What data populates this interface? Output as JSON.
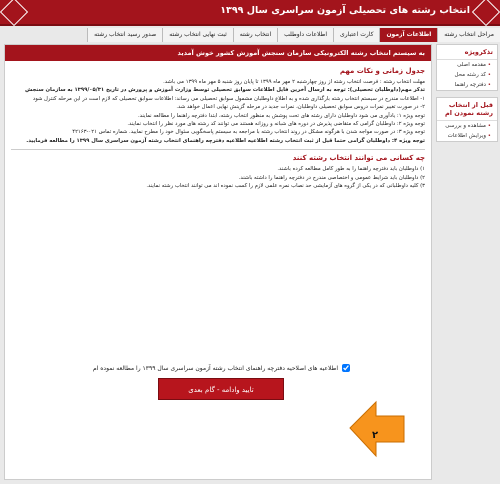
{
  "header": {
    "title": "انتخاب رشته های تحصیلی آزمون سراسری سال ۱۳۹۹"
  },
  "tabs": [
    {
      "label": "مراحل انتخاب رشته"
    },
    {
      "label": "اطلاعات آزمون"
    },
    {
      "label": "کارت اعتباری"
    },
    {
      "label": "اطلاعات داوطلب"
    },
    {
      "label": "انتخاب رشته"
    },
    {
      "label": "ثبت نهایی انتخاب رشته"
    },
    {
      "label": "صدور رسید انتخاب رشته"
    }
  ],
  "welcome": "به سیستم انتخاب رشته الکترونیکی سازمان سنجش آموزش کشور خوش آمدید",
  "sidebar": {
    "box1": {
      "title": "تذکرویژه",
      "items": [
        "مقدمه اصلی",
        "کد رشته محل",
        "دفترچه راهنما"
      ]
    },
    "box2": {
      "title": "قبل از انتخاب رشته نمودن ام",
      "items": [
        "مشاهده و بررسی",
        "ویرایش اطلاعات"
      ]
    }
  },
  "main": {
    "h1": "جدول زمانی و نکات مهم",
    "p1": "مهلت انتخاب رشته : فرصت انتخاب رشته از روز چهارشنبه ۲ مهر ماه ۱۳۹۹ تا پایان روز شنبه ۵ مهر ماه ۱۳۹۹ می باشد.",
    "p2": "تذکر مهم(داوطلبان تحصیلی): توجه به ارسال آخرین فایل اطلاعات سوابق تحصیلی توسط وزارت آموزش و پرورش در تاریخ ۱۳۹۹/۰۵/۳۱ به سازمان سنجش",
    "p3": "۱- اطلاعات مندرج در سیستم انتخاب رشته بارگذاری شده و به اطلاع داوطلبان مشمول سوابق تحصیلی می رساند: اطلاعات سوابق تحصیلی که لازم است در این مرحله کنترل شود",
    "p4": "۲- در صورت تغییر نمرات دروس سوابق تحصیلی داوطلبان، نمرات جدید در مرحله گزینش نهایی اعمال خواهد شد.",
    "p5": "توجه ویژه ۱: یادآوری می شود داوطلبان دارای رشته های تحت پوشش به منظور انتخاب رشته، ابتدا دفترچه راهنما را مطالعه نمایند.",
    "p6": "توجه ویژه ۲: داوطلبان گرامی که متقاضی پذیرش در دوره های شبانه و روزانه هستند می توانند کد رشته های مورد نظر را انتخاب نمایند.",
    "p7": "توجه ویژه ۳: در صورت مواجه شدن با هرگونه مشکل در روند انتخاب رشته با مراجعه به سیستم پاسخگویی سئوال خود را مطرح نمایید. شماره تماس ۰۲۱-۴۲۱۶۳",
    "p8": "توجه ویژه ۴: داوطلبان گرامی حتما قبل از ثبت انتخاب رشته اطلاعیه اطلاعیه دفترچه راهنمای انتخاب رشته آزمون سراسری سال ۱۳۹۹ را مطالعه فرمایید.",
    "h2": "چه کسانی می توانند انتخاب رشته کنند",
    "q1": "۱) داوطلبان باید دفترچه راهنما را به طور کامل مطالعه کرده باشند.",
    "q2": "۲) داوطلبان باید شرایط عمومی و اختصاصی مندرج در دفترچه راهنما را داشته باشند.",
    "q3": "۳) کلیه داوطلبانی که در یکی از گروه های آزمایشی حد نصاب نمره علمی لازم را کسب نموده اند می توانند انتخاب رشته نمایند."
  },
  "agree": "اطلاعیه های اصلاحیه دفترچه راهنمای انتخاب رشته آزمون سراسری سال ۱۳۹۹ را مطالعه نموده ام",
  "button": "تایید وادامه - گام بعدی",
  "step": "۲"
}
